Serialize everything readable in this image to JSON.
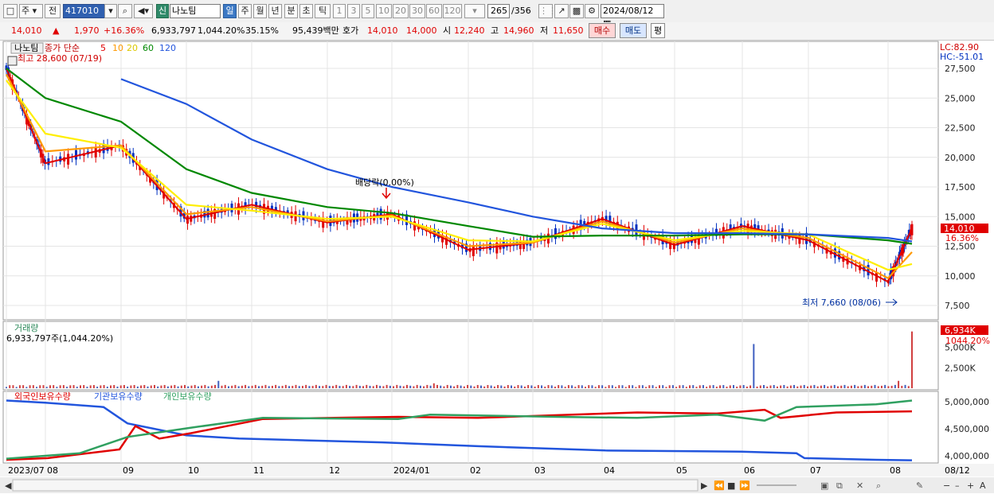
{
  "toolbar": {
    "icon1": "window-icon",
    "mode": "주",
    "prev": "전",
    "code": "417010",
    "sin": "신",
    "name": "나노팀",
    "periods": [
      "일",
      "주",
      "월",
      "년",
      "분",
      "초",
      "틱"
    ],
    "active_period": "일",
    "intervals": [
      "1",
      "3",
      "5",
      "10",
      "20",
      "30",
      "60",
      "120"
    ],
    "count": "265",
    "total": "/356",
    "date": "2024/08/12"
  },
  "info": {
    "price": "14,010",
    "change": "1,970",
    "change_pct": "+16.36%",
    "volume": "6,933,797",
    "vol_pct": "1,044.20%",
    "turnover": "35.15%",
    "amount": "95,439백만",
    "quote_label": "호가",
    "ask": "14,010",
    "bid": "14,000",
    "open_label": "시",
    "open": "12,240",
    "high_label": "고",
    "high": "14,960",
    "low_label": "저",
    "low": "11,650",
    "buy": "매수",
    "sell": "매도",
    "eval": "평"
  },
  "price_panel": {
    "name": "나노팀",
    "legend_label": "종가 단순",
    "ma_periods": [
      "5",
      "10",
      "20",
      "60",
      "120"
    ],
    "ma_colors": [
      "#e00000",
      "#ff9900",
      "#ffee00",
      "#008800",
      "#2255dd"
    ],
    "max_label": "최고 28,600 (07/19)",
    "min_label": "최저 7,660 (08/06)",
    "dividend_label": "배당락(0.00%)",
    "lc": "LC:82.90",
    "hc": "HC:-51.01",
    "last_price": "14,010",
    "last_pct": "16.36%"
  },
  "volume_panel": {
    "title": "거래량",
    "value": "6,933,797주(1,044.20%)",
    "last": "6,934K",
    "last_pct": "1044.20%"
  },
  "holdings_panel": {
    "labels": [
      "외국인보유수량",
      "기관보유수량",
      "개인보유수량"
    ],
    "colors": [
      "#e00000",
      "#2255dd",
      "#30a060"
    ]
  },
  "axis": {
    "price_ticks": [
      "27,500",
      "25,000",
      "22,500",
      "20,000",
      "17,500",
      "15,000",
      "12,500",
      "10,000",
      "7,500"
    ],
    "volume_ticks": [
      "5,000K",
      "2,500K"
    ],
    "holding_ticks": [
      "5,000,000",
      "4,500,000",
      "4,000,000"
    ],
    "x_labels": [
      "2023/07",
      "08",
      "09",
      "10",
      "11",
      "12",
      "2024/01",
      "02",
      "03",
      "04",
      "05",
      "06",
      "07",
      "08"
    ],
    "x_end": "08/12"
  },
  "chart_data": {
    "type": "line",
    "title": "",
    "x": [
      "2023/07",
      "08",
      "09",
      "10",
      "11",
      "12",
      "2024/01",
      "02",
      "03",
      "04",
      "05",
      "06",
      "07",
      "08",
      "08/12"
    ],
    "series": [
      {
        "name": "5",
        "values": [
          27500,
          19500,
          21000,
          14800,
          16000,
          14500,
          15200,
          12200,
          12800,
          14800,
          12600,
          14200,
          13000,
          9500,
          14010
        ]
      },
      {
        "name": "10",
        "values": [
          27000,
          20500,
          21000,
          15200,
          15800,
          14600,
          15100,
          12500,
          12800,
          14600,
          12800,
          14000,
          13200,
          9800,
          12000
        ]
      },
      {
        "name": "20",
        "values": [
          26500,
          22000,
          20800,
          16000,
          15500,
          14800,
          15000,
          13000,
          12900,
          14400,
          13000,
          13800,
          13500,
          10500,
          11000
        ]
      },
      {
        "name": "60",
        "values": [
          27500,
          25000,
          23000,
          19000,
          17000,
          15800,
          15300,
          14200,
          13300,
          13400,
          13400,
          13500,
          13500,
          13000,
          12700
        ]
      },
      {
        "name": "120",
        "values": [
          null,
          null,
          26600,
          24500,
          21500,
          19000,
          17500,
          16200,
          15000,
          14000,
          13600,
          13600,
          13500,
          13200,
          12900
        ]
      }
    ],
    "ylim": [
      7500,
      28600
    ],
    "events": {
      "high": {
        "value": 28600,
        "date": "07/19"
      },
      "low": {
        "value": 7660,
        "date": "08/06"
      }
    }
  }
}
